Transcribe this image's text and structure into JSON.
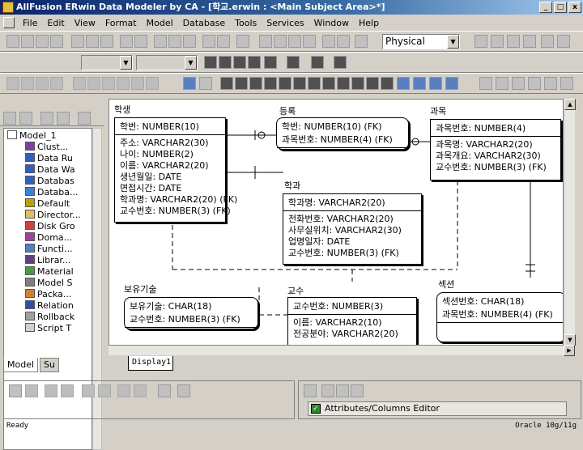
{
  "window": {
    "title": "AllFusion ERwin Data Modeler by CA - [학교.erwin : <Main Subject Area>*]",
    "min_label": "_",
    "max_label": "□",
    "close_label": "x"
  },
  "menu": [
    "File",
    "Edit",
    "View",
    "Format",
    "Model",
    "Database",
    "Tools",
    "Services",
    "Window",
    "Help"
  ],
  "toolbar": {
    "view_select": "Physical"
  },
  "tree": {
    "items": [
      "Model_1",
      "Clust...",
      "Data Ru",
      "Data Wa",
      "Databas",
      "Databa...",
      "Default",
      "Director...",
      "Disk Gro",
      "Doma...",
      "Functi...",
      "Librar...",
      "Material",
      "Model S",
      "Packa...",
      "Relation",
      "Rollback",
      "Script T"
    ]
  },
  "left_tabs": [
    "Model",
    "Su"
  ],
  "entities": [
    {
      "name": "학생",
      "key": [
        "학번: NUMBER(10)"
      ],
      "attrs": [
        "주소: VARCHAR2(30)",
        "나이: NUMBER(2)",
        "이름: VARCHAR2(20)",
        "생년월일: DATE",
        "면접시간: DATE",
        "학과명: VARCHAR2(20) (FK)",
        "교수번호: NUMBER(3) (FK)"
      ]
    },
    {
      "name": "등록",
      "key": [
        "학번: NUMBER(10) (FK)",
        "과목번호: NUMBER(4) (FK)"
      ],
      "attrs": []
    },
    {
      "name": "과목",
      "key": [
        "과목번호: NUMBER(4)"
      ],
      "attrs": [
        "과목명: VARCHAR2(20)",
        "과목개요: VARCHAR2(30)",
        "교수번호: NUMBER(3) (FK)"
      ]
    },
    {
      "name": "학과",
      "key": [
        "학과명: VARCHAR2(20)"
      ],
      "attrs": [
        "전화번호: VARCHAR2(20)",
        "사무실위치: VARCHAR2(30)",
        "업명일자: DATE",
        "교수번호: NUMBER(3) (FK)"
      ]
    },
    {
      "name": "보유기술",
      "key": [
        "보유기술: CHAR(18)",
        "교수번호: NUMBER(3) (FK)"
      ],
      "attrs": []
    },
    {
      "name": "교수",
      "key": [
        "교수번호: NUMBER(3)"
      ],
      "attrs": [
        "이름: VARCHAR2(10)",
        "전공분야: VARCHAR2(20)"
      ]
    },
    {
      "name": "섹션",
      "key": [
        "섹션번호: CHAR(18)",
        "과목번호: NUMBER(4) (FK)"
      ],
      "attrs": []
    }
  ],
  "canvas_tab": "Display1",
  "attributes_editor": "Attributes/Columns Editor",
  "status": {
    "left": "Ready",
    "right": "Oracle 10g/11g"
  }
}
